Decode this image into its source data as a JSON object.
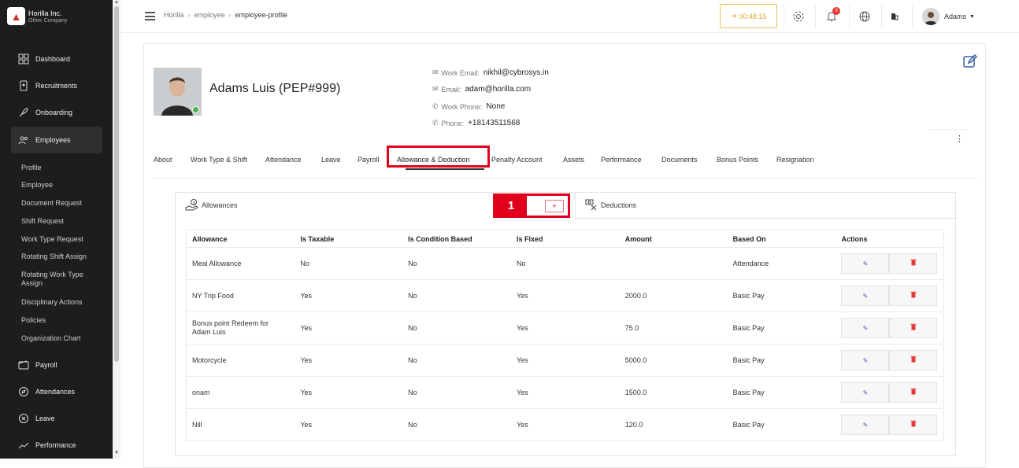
{
  "brand": {
    "name": "Horilla Inc.",
    "sub": "Other Company"
  },
  "sidebar": {
    "items": [
      {
        "label": "Dashboard",
        "icon": "dashboard-icon"
      },
      {
        "label": "Recruitments",
        "icon": "recruitment-icon"
      },
      {
        "label": "Onboarding",
        "icon": "rocket-icon"
      },
      {
        "label": "Employees",
        "icon": "users-icon"
      },
      {
        "label": "Payroll",
        "icon": "wallet-icon"
      },
      {
        "label": "Attendances",
        "icon": "compass-icon"
      },
      {
        "label": "Leave",
        "icon": "leave-icon"
      },
      {
        "label": "Performance",
        "icon": "trend-icon"
      }
    ],
    "subitems": [
      "Profile",
      "Employee",
      "Document Request",
      "Shift Request",
      "Work Type Request",
      "Rotating Shift Assign",
      "Rotating Work Type Assign",
      "Disciplinary Actions",
      "Policies",
      "Organization Chart"
    ]
  },
  "header": {
    "breadcrumbs": [
      "Horilla",
      "employee",
      "employee-profile"
    ],
    "timer": "00:48:15",
    "notification_count": "0",
    "user": "Adams"
  },
  "profile": {
    "name": "Adams Luis (PEP#999)",
    "contacts": [
      {
        "label": "Work Email:",
        "value": "nikhil@cybrosys.in",
        "icon": "mail-icon"
      },
      {
        "label": "Email:",
        "value": "adam@horilla.com",
        "icon": "mail-icon"
      },
      {
        "label": "Work Phone:",
        "value": "None",
        "icon": "phone-icon"
      },
      {
        "label": "Phone:",
        "value": "+18143511568",
        "icon": "phone-icon"
      }
    ]
  },
  "tabs": [
    "About",
    "Work Type & Shift",
    "Attendance",
    "Leave",
    "Payroll",
    "Allowance & Deduction",
    "Penalty Account",
    "Assets",
    "Performance",
    "Documents",
    "Bonus Points",
    "Resignation"
  ],
  "sections": {
    "allowances": "Allowances",
    "deductions": "Deductions",
    "marker": "1",
    "add": "+"
  },
  "table": {
    "headers": [
      "Allowance",
      "Is Taxable",
      "Is Condition Based",
      "Is Fixed",
      "Amount",
      "Based On",
      "Actions"
    ],
    "rows": [
      [
        "Meal Allowance",
        "No",
        "No",
        "No",
        "",
        "Attendance"
      ],
      [
        "NY Trip Food",
        "Yes",
        "No",
        "Yes",
        "2000.0",
        "Basic Pay"
      ],
      [
        "Bonus point Redeem for Adam Luis",
        "Yes",
        "No",
        "Yes",
        "75.0",
        "Basic Pay"
      ],
      [
        "Motorcycle",
        "Yes",
        "No",
        "Yes",
        "5000.0",
        "Basic Pay"
      ],
      [
        "onam",
        "Yes",
        "No",
        "Yes",
        "1500.0",
        "Basic Pay"
      ],
      [
        "Nill",
        "Yes",
        "No",
        "Yes",
        "120.0",
        "Basic Pay"
      ]
    ]
  }
}
